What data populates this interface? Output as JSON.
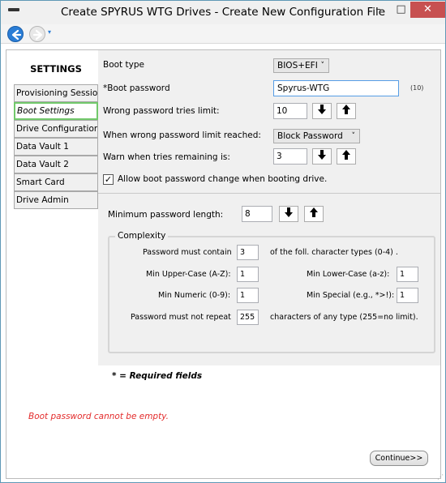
{
  "window": {
    "title": "Create SPYRUS WTG Drives - Create New Configuration File",
    "minimize": "–",
    "maximize": "□",
    "close": "✕"
  },
  "nav": {
    "back_icon": "back-arrow-icon",
    "forward_icon": "forward-arrow-icon",
    "dropdown_glyph": "▾"
  },
  "sidebar": {
    "title": "SETTINGS",
    "items": [
      {
        "label": "Provisioning Session"
      },
      {
        "label": "Boot Settings",
        "active": true
      },
      {
        "label": "Drive Configuration"
      },
      {
        "label": "Data Vault 1"
      },
      {
        "label": "Data Vault 2"
      },
      {
        "label": "Smart Card"
      },
      {
        "label": "Drive Admin"
      }
    ]
  },
  "boot": {
    "boot_type_label": "Boot type",
    "boot_type_value": "BIOS+EFI",
    "password_label": "*Boot password",
    "password_value": "Spyrus-WTG",
    "password_note": "(10)",
    "wrong_limit_label": "Wrong password tries limit:",
    "wrong_limit_value": "10",
    "on_limit_label": "When wrong password limit reached:",
    "on_limit_value": "Block Password",
    "warn_label": "Warn when tries remaining is:",
    "warn_value": "3",
    "allow_change_label": "Allow boot password change when booting drive.",
    "allow_change_checked": "✓",
    "spin_down": "🡻",
    "spin_up": "🡹",
    "dropdown_arrow": "˅"
  },
  "password_policy": {
    "min_length_label": "Minimum password length:",
    "min_length_value": "8",
    "complexity_title": "Complexity",
    "must_contain_label": "Password must contain",
    "must_contain_value": "3",
    "must_contain_suffix": "of the foll. character types (0-4) .",
    "min_upper_label": "Min Upper-Case (A-Z):",
    "min_upper_value": "1",
    "min_lower_label": "Min Lower-Case (a-z):",
    "min_lower_value": "1",
    "min_numeric_label": "Min Numeric (0-9):",
    "min_numeric_value": "1",
    "min_special_label": "Min Special (e.g., *>!):",
    "min_special_value": "1",
    "no_repeat_label": "Password must not repeat",
    "no_repeat_value": "255",
    "no_repeat_suffix": "characters of any type (255=no limit)."
  },
  "footer": {
    "required_prefix": "* = ",
    "required_text": "Required fields",
    "error_text": "Boot password cannot be empty.",
    "continue_label": "Continue>>"
  }
}
